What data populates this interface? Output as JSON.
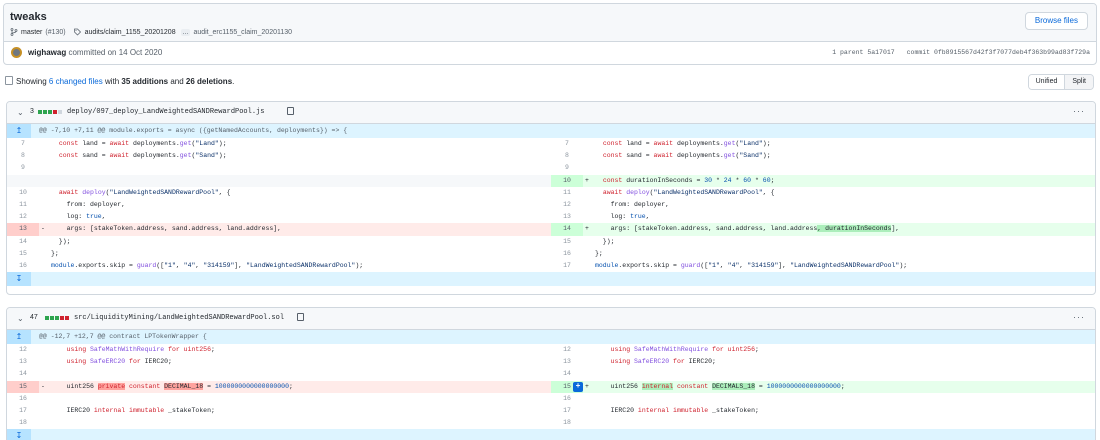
{
  "commit": {
    "title": "tweaks",
    "branch": "master",
    "pr": "(#130)",
    "tag": "audits/claim_1155_20201208",
    "more": "...",
    "tag2": "audit_erc1155_claim_20201130",
    "browse_label": "Browse files",
    "author": "wighawag",
    "committed_text": " committed on 14 Oct 2020",
    "parent_text": "1 parent 5a17017",
    "commit_text": "commit 0fb8915567d42f3f7077deb4f363b99ad83f729a"
  },
  "toolbar": {
    "showing_prefix": "Showing ",
    "changed_files": "6 changed files",
    "with_text": " with ",
    "additions": "35 additions",
    "and_text": " and ",
    "deletions": "26 deletions",
    "end": ".",
    "unified_label": "Unified",
    "split_label": "Split"
  },
  "files": [
    {
      "count": "3",
      "path": "deploy/097_deploy_LandWeightedSANDRewardPool.js",
      "hunk": "@@ -7,10 +7,11 @@ module.exports = async ({getNamedAccounts, deployments}) => {"
    },
    {
      "count": "47",
      "path": "src/LiquidityMining/LandWeightedSANDRewardPool.sol",
      "hunk": "@@ -12,7 +12,7 @@ contract LPTokenWrapper {"
    }
  ],
  "icons": [
    "branch-icon",
    "tag-icon",
    "file-diff-icon",
    "chevron-down-icon",
    "copy-icon",
    "kebab-icon",
    "expand-up-icon",
    "expand-down-icon",
    "add-comment-icon"
  ]
}
